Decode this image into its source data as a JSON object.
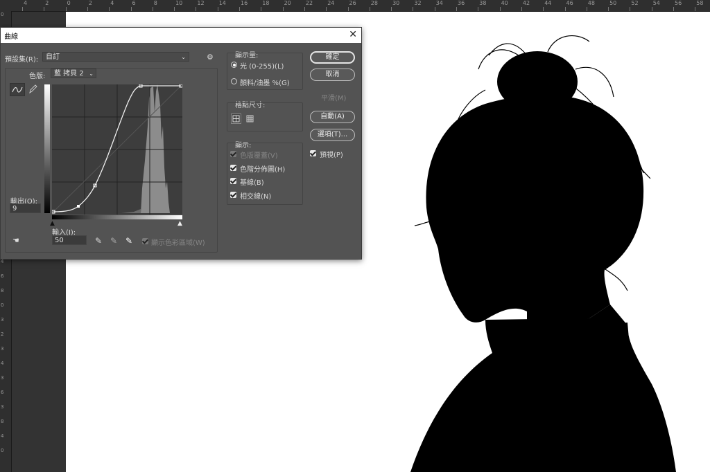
{
  "ruler": {
    "top_labels": [
      "4",
      "2",
      "0",
      "2",
      "4",
      "6",
      "8",
      "10",
      "12",
      "14",
      "16",
      "18",
      "20",
      "22",
      "24",
      "26",
      "28",
      "30",
      "32",
      "34",
      "36",
      "38",
      "40",
      "42",
      "44",
      "46",
      "48",
      "50",
      "52",
      "54",
      "56",
      "58"
    ],
    "left_labels": [
      "0",
      "2",
      "4",
      "6",
      "8",
      "0",
      "1",
      "2",
      "4",
      "6",
      "8",
      "1",
      "2",
      "4",
      "6",
      "8",
      "2",
      "4",
      "6",
      "8",
      "0",
      "3",
      "2",
      "3",
      "4",
      "3",
      "6",
      "3",
      "8",
      "4",
      "0"
    ]
  },
  "dialog": {
    "title": "曲線",
    "preset_label": "預設集(R):",
    "preset_value": "自訂",
    "channel_label": "色版:",
    "channel_value": "藍 拷貝 2",
    "output_label": "輸出(O):",
    "output_value": "9",
    "input_label": "輸入(I):",
    "input_value": "50",
    "show_clipping_label": "顯示色彩區域(W)",
    "display_amount": {
      "title": "顯示量:",
      "light_label": "光 (0-255)(L)",
      "pigment_label": "顏料/油墨 %(G)",
      "selected": "light"
    },
    "grid_size": {
      "title": "格點尺寸:"
    },
    "show": {
      "title": "顯示:",
      "channel_overlays": "色版覆蓋(V)",
      "histogram": "色階分佈圖(H)",
      "baseline": "基線(B)",
      "intersection": "相交線(N)"
    },
    "buttons": {
      "ok": "確定",
      "cancel": "取消",
      "smooth": "平滑(M)",
      "auto": "自動(A)",
      "options": "選項(T)..."
    },
    "preview_label": "預視(P)",
    "curve_points": [
      [
        0,
        0
      ],
      [
        50,
        9
      ],
      [
        80,
        40
      ],
      [
        165,
        255
      ],
      [
        255,
        255
      ]
    ]
  },
  "colors": {
    "dialog_bg": "#535353",
    "graph_bg": "#3d3d3d",
    "histogram": "#8c8c8c",
    "canvas": "#ffffff",
    "silhouette": "#000000"
  }
}
